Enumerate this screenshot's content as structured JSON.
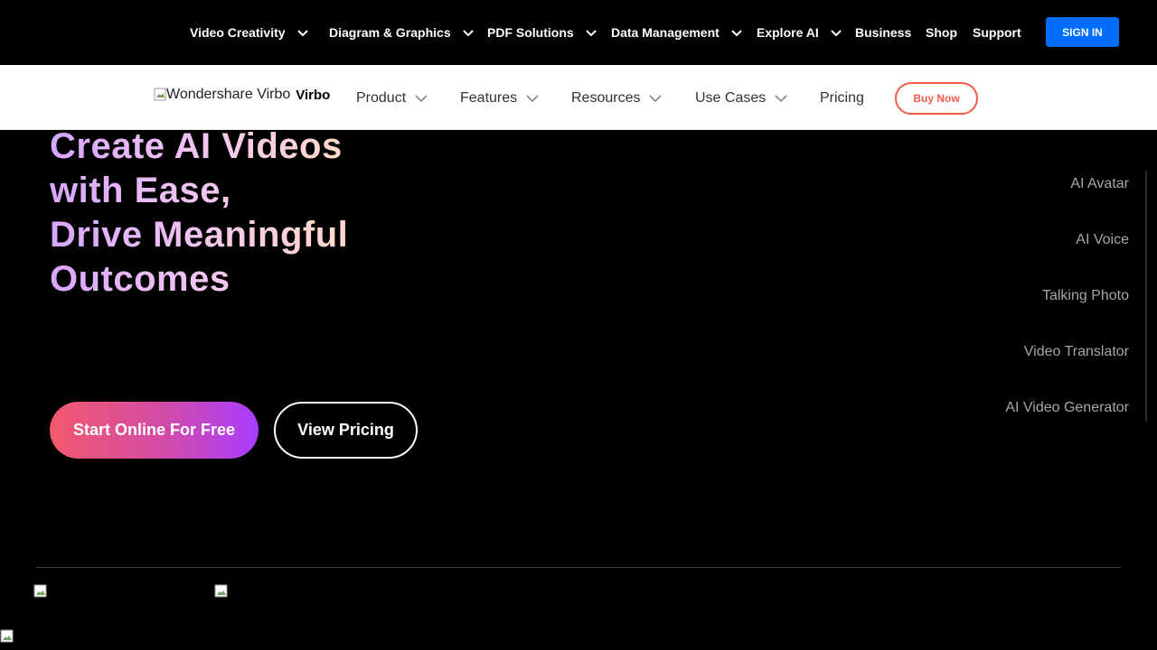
{
  "topnav": {
    "items": [
      {
        "label": "Video Creativity",
        "dropdown": true
      },
      {
        "label": "Diagram & Graphics",
        "dropdown": true
      },
      {
        "label": "PDF Solutions",
        "dropdown": true
      },
      {
        "label": "Data Management",
        "dropdown": true
      },
      {
        "label": "Explore AI",
        "dropdown": true
      },
      {
        "label": "Business",
        "dropdown": false
      },
      {
        "label": "Shop",
        "dropdown": false
      },
      {
        "label": "Support",
        "dropdown": false
      }
    ],
    "signin_label": "SIGN IN"
  },
  "subnav": {
    "logo_alt": "Wondershare Virbo",
    "brand_name": "Virbo",
    "items": [
      {
        "label": "Product",
        "dropdown": true
      },
      {
        "label": "Features",
        "dropdown": true
      },
      {
        "label": "Resources",
        "dropdown": true
      },
      {
        "label": "Use Cases",
        "dropdown": true
      },
      {
        "label": "Pricing",
        "dropdown": false
      }
    ],
    "buy_label": "Buy Now"
  },
  "hero": {
    "title_lines": [
      "Create AI Videos",
      "with Ease,",
      "Drive Meaningful",
      "Outcomes"
    ],
    "start_label": "Start Online For Free",
    "pricing_label": "View Pricing"
  },
  "features": [
    "AI Avatar",
    "AI Voice",
    "Talking Photo",
    "Video Translator",
    "AI Video Generator"
  ],
  "colors": {
    "accent_blue": "#006dff",
    "buy_red": "#f45a4a",
    "gradient_start": "#f2596a",
    "gradient_end": "#a83cff"
  }
}
